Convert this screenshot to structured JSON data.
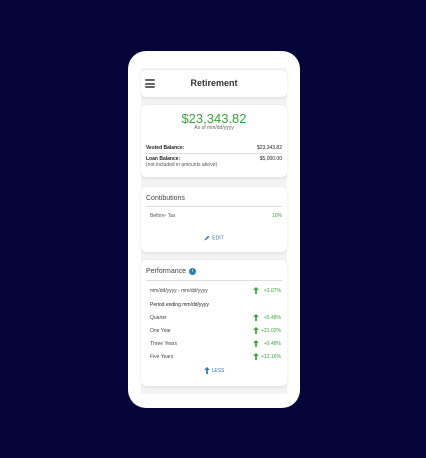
{
  "header": {
    "title": "Retirement"
  },
  "balance": {
    "amount": "$23,343.82",
    "as_of": "As of mm/dd/yyyy",
    "vested_label": "Vested Balance:",
    "vested_value": "$23,343.82",
    "loan_label": "Loan Balance:",
    "loan_value": "$5,000.00",
    "loan_note": "(not included in amounts above)"
  },
  "contributions": {
    "title": "Contibutions",
    "rows": [
      {
        "label": "Before- Tax",
        "value": "10%"
      }
    ],
    "edit_label": "EDIT"
  },
  "performance": {
    "title": "Performance",
    "info_icon_glyph": "i",
    "date_range": "mm/dd/yyyy - mm/dd/yyyy",
    "date_range_value": "+3.07%",
    "period_label": "Period ending mm/dd/yyyy",
    "rows": [
      {
        "label": "Quarter",
        "value": "+5.48%"
      },
      {
        "label": "One Year",
        "value": "+21.02%"
      },
      {
        "label": "Three Years",
        "value": "+9.48%"
      },
      {
        "label": "Five Years",
        "value": "+12.16%"
      }
    ],
    "less_label": "LESS"
  },
  "colors": {
    "background": "#06053a",
    "positive": "#3aa53a",
    "link": "#2a7ea9"
  },
  "icons": [
    "hamburger-menu-icon",
    "pencil-icon",
    "info-icon",
    "arrow-up-icon"
  ]
}
